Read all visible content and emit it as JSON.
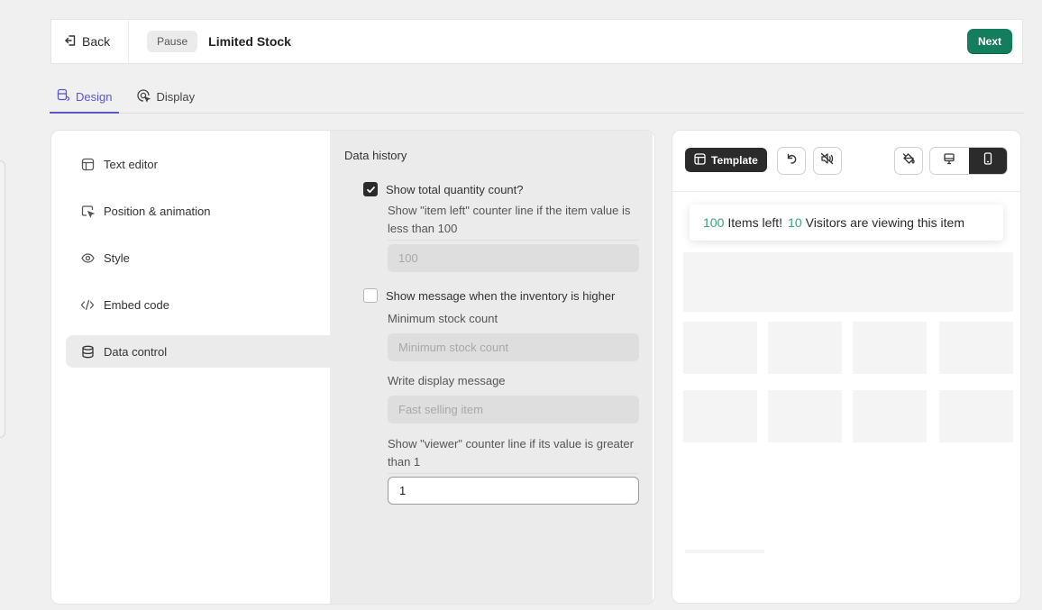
{
  "header": {
    "back_label": "Back",
    "pause_label": "Pause",
    "title": "Limited Stock",
    "next_label": "Next"
  },
  "tabs": [
    {
      "label": "Design",
      "active": true,
      "icon": "design-icon"
    },
    {
      "label": "Display",
      "active": false,
      "icon": "display-cursor-icon"
    }
  ],
  "sidebar": {
    "items": [
      {
        "label": "Text editor",
        "icon": "layout-icon"
      },
      {
        "label": "Position & animation",
        "icon": "pointer-icon"
      },
      {
        "label": "Style",
        "icon": "eye-icon"
      },
      {
        "label": "Embed code",
        "icon": "code-icon"
      },
      {
        "label": "Data control",
        "icon": "database-icon",
        "active": true
      }
    ]
  },
  "data_control": {
    "section_title": "Data history",
    "total_quantity": {
      "label": "Show total quantity count?",
      "checked": true,
      "desc": "Show \"item left\" counter line if the item value is less than 100",
      "placeholder": "100"
    },
    "inventory_higher": {
      "label": "Show message when the inventory is higher",
      "checked": false,
      "min_label": "Minimum stock count",
      "min_placeholder": "Minimum stock count",
      "msg_label": "Write display message",
      "msg_placeholder": "Fast selling item"
    },
    "viewer": {
      "desc": "Show \"viewer\" counter line if its value is greater than 1",
      "value": "1"
    }
  },
  "preview": {
    "template_label": "Template",
    "notice": {
      "items_count": "100",
      "items_text": "Items left!",
      "visitors_count": "10",
      "visitors_text": "Visitors are viewing this item"
    }
  },
  "colors": {
    "accent": "#5b56c9",
    "next_button": "#137d5e",
    "count_green": "#3aa57a"
  }
}
